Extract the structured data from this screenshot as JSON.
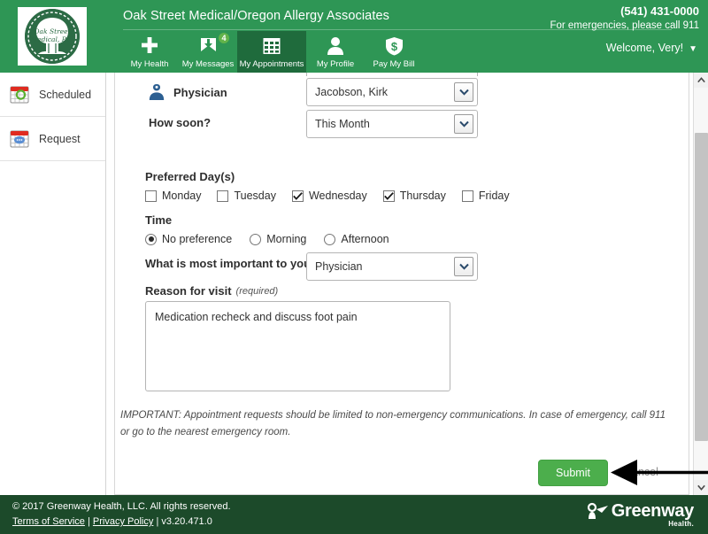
{
  "header": {
    "practice_name": "Oak Street Medical/Oregon Allergy Associates",
    "phone": "(541) 431-0000",
    "emergency_text": "For emergencies, please call 911",
    "welcome": "Welcome, Very!",
    "welcome_caret": "▼",
    "logo_line1": "Oak Street",
    "logo_line2": "Medical, P.C.",
    "brand_green": "#2e9655",
    "active_tab_green": "#1f6b3c"
  },
  "nav": {
    "items": [
      {
        "label": "My Health",
        "icon": "plus-icon",
        "active": false,
        "badge": ""
      },
      {
        "label": "My Messages",
        "icon": "envelope-download-icon",
        "active": false,
        "badge": "4"
      },
      {
        "label": "My Appointments",
        "icon": "calendar-grid-icon",
        "active": true,
        "badge": ""
      },
      {
        "label": "My Profile",
        "icon": "person-icon",
        "active": false,
        "badge": ""
      },
      {
        "label": "Pay My Bill",
        "icon": "dollar-shield-icon",
        "active": false,
        "badge": ""
      }
    ]
  },
  "sidebar": {
    "items": [
      {
        "label": "Scheduled",
        "icon": "calendar-check-icon"
      },
      {
        "label": "Request",
        "icon": "calendar-message-icon"
      }
    ]
  },
  "form": {
    "physician": {
      "label": "Physician",
      "icon": "physician-person-icon",
      "value": "Jacobson, Kirk"
    },
    "how_soon": {
      "label": "How soon?",
      "value": "This Month"
    },
    "preferred_days": {
      "label": "Preferred Day(s)",
      "options": [
        {
          "label": "Monday",
          "checked": false
        },
        {
          "label": "Tuesday",
          "checked": false
        },
        {
          "label": "Wednesday",
          "checked": true
        },
        {
          "label": "Thursday",
          "checked": true
        },
        {
          "label": "Friday",
          "checked": false
        }
      ]
    },
    "time": {
      "label": "Time",
      "options": [
        {
          "label": "No preference",
          "selected": true
        },
        {
          "label": "Morning",
          "selected": false
        },
        {
          "label": "Afternoon",
          "selected": false
        }
      ]
    },
    "most_important": {
      "label": "What is most important to you?",
      "value": "Physician"
    },
    "reason": {
      "label": "Reason for visit",
      "required_note": "(required)",
      "value": "Medication recheck and discuss foot pain"
    },
    "important_note": "IMPORTANT: Appointment requests should be limited to non-emergency communications. In case of emergency, call 911 or go to the nearest emergency room.",
    "submit_label": "Submit",
    "cancel_label": "Cancel",
    "submit_color": "#4cae4c"
  },
  "footer": {
    "copyright": "© 2017 Greenway Health, LLC. All rights reserved.",
    "terms_label": "Terms of Service",
    "sep1": "|",
    "privacy_label": "Privacy Policy",
    "sep2": "|",
    "version": "v3.20.471.0",
    "logo_text": "Greenway",
    "logo_sub": "Health.",
    "background": "#1c4a2a"
  },
  "scrollbar": {
    "up_arrow": "⌃",
    "down_arrow": "⌄"
  },
  "annotation": {
    "type": "arrow-pointing-left-at-submit-button",
    "color": "#000000"
  }
}
